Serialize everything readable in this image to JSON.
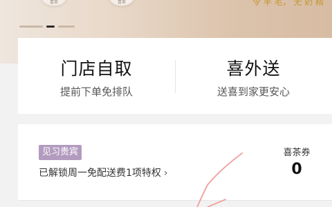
{
  "banner": {
    "cup_labels": [
      "喜茶",
      "喜茶"
    ],
    "promo_text": "令 半 毛， 无 奶 精"
  },
  "order_options": [
    {
      "title": "门店自取",
      "subtitle": "提前下单免排队"
    },
    {
      "title": "喜外送",
      "subtitle": "送喜到家更安心"
    }
  ],
  "membership": {
    "level_badge": "见习贵宾",
    "benefit_text": "已解锁周一免配送费1项特权",
    "chevron": "›",
    "coupon_label": "喜茶券",
    "coupon_count": "0"
  },
  "colors": {
    "badge_bg": "#b39bbf",
    "promo_gold": "#c7962f",
    "scribble": "#f1a5a5"
  }
}
